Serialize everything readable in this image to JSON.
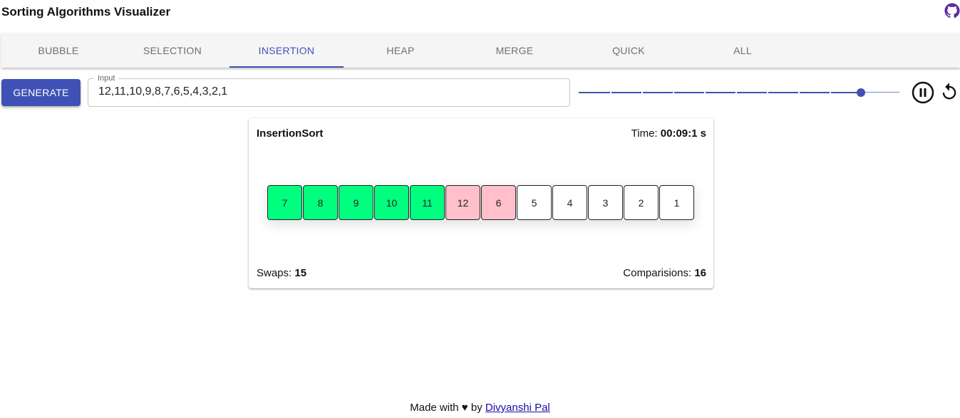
{
  "app": {
    "title": "Sorting Algorithms Visualizer",
    "github_icon": "github-icon",
    "github_color": "#5b2ca0"
  },
  "tabs": [
    {
      "label": "BUBBLE",
      "active": false
    },
    {
      "label": "SELECTION",
      "active": false
    },
    {
      "label": "INSERTION",
      "active": true
    },
    {
      "label": "HEAP",
      "active": false
    },
    {
      "label": "MERGE",
      "active": false
    },
    {
      "label": "QUICK",
      "active": false
    },
    {
      "label": "ALL",
      "active": false
    }
  ],
  "controls": {
    "generate_label": "GENERATE",
    "input_label": "Input",
    "input_value": "12,11,10,9,8,7,6,5,4,3,2,1",
    "speed_slider": {
      "steps": 10,
      "value_fraction": 0.88
    },
    "pause_icon": "pause-circle-icon",
    "reset_icon": "restart-icon"
  },
  "visualizer": {
    "title": "InsertionSort",
    "time_label": "Time:",
    "time_value": "00:09:1 s",
    "array": [
      {
        "value": "7",
        "state": "sorted"
      },
      {
        "value": "8",
        "state": "sorted"
      },
      {
        "value": "9",
        "state": "sorted"
      },
      {
        "value": "10",
        "state": "sorted"
      },
      {
        "value": "11",
        "state": "sorted"
      },
      {
        "value": "12",
        "state": "comparing"
      },
      {
        "value": "6",
        "state": "comparing"
      },
      {
        "value": "5",
        "state": "default"
      },
      {
        "value": "4",
        "state": "default"
      },
      {
        "value": "3",
        "state": "default"
      },
      {
        "value": "2",
        "state": "default"
      },
      {
        "value": "1",
        "state": "default"
      }
    ],
    "swaps_label": "Swaps:",
    "swaps_value": "15",
    "comparisons_label": "Comparisions:",
    "comparisons_value": "16"
  },
  "colors": {
    "accent": "#3f51b5",
    "sorted": "#00ff7f",
    "comparing": "#ffc0cb",
    "default": "#ffffff"
  },
  "footer": {
    "text_before": "Made with",
    "heart": "♥",
    "by": "by",
    "author_link": "Divyanshi Pal"
  }
}
